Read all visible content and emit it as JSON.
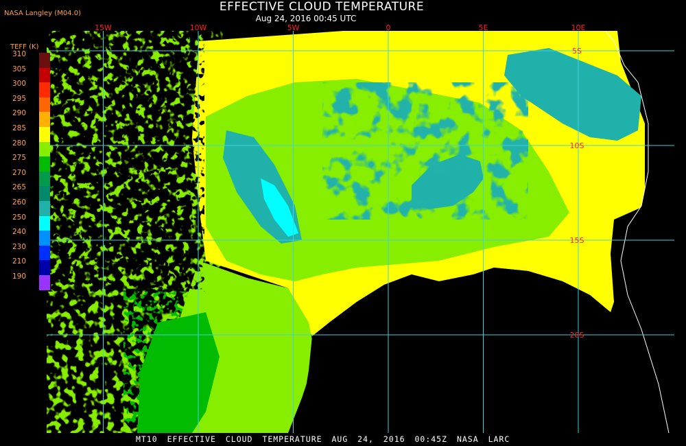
{
  "header": {
    "credit": "NASA Langley (M04.0)",
    "title": "EFFECTIVE CLOUD TEMPERATURE",
    "subtitle": "Aug 24, 2016 00:45 UTC"
  },
  "footer": {
    "caption": "MT10  EFFECTIVE CLOUD TEMPERATURE  AUG 24, 2016 00:45Z  NASA LARC"
  },
  "legend": {
    "title": "TEFF (K)",
    "entries": [
      {
        "label": "310",
        "color": "#6b0f0f"
      },
      {
        "label": "305",
        "color": "#c40000"
      },
      {
        "label": "300",
        "color": "#ff2a00"
      },
      {
        "label": "295",
        "color": "#ff6600"
      },
      {
        "label": "290",
        "color": "#ffb000"
      },
      {
        "label": "285",
        "color": "#ffff00"
      },
      {
        "label": "280",
        "color": "#88ee00"
      },
      {
        "label": "275",
        "color": "#00bb00"
      },
      {
        "label": "270",
        "color": "#009a4a"
      },
      {
        "label": "265",
        "color": "#008a6a"
      },
      {
        "label": "260",
        "color": "#20b2aa"
      },
      {
        "label": "250",
        "color": "#00ffff"
      },
      {
        "label": "240",
        "color": "#0090ff"
      },
      {
        "label": "230",
        "color": "#0030ff"
      },
      {
        "label": "210",
        "color": "#0000aa"
      },
      {
        "label": "190",
        "color": "#9933ff"
      }
    ]
  },
  "map": {
    "longitudes": [
      {
        "label": "15W",
        "lon": -15
      },
      {
        "label": "10W",
        "lon": -10
      },
      {
        "label": "5W",
        "lon": -5
      },
      {
        "label": "0",
        "lon": 0
      },
      {
        "label": "5E",
        "lon": 5
      },
      {
        "label": "10E",
        "lon": 10
      }
    ],
    "latitudes": [
      {
        "label": "5S",
        "lat": -5
      },
      {
        "label": "10S",
        "lat": -10
      },
      {
        "label": "15S",
        "lat": -15
      },
      {
        "label": "20S",
        "lat": -20
      }
    ],
    "colors": {
      "grid": "#40d0e0",
      "grid_label": "#ff2020",
      "coastline": "#ffffff",
      "no_cloud": "#000000"
    }
  }
}
